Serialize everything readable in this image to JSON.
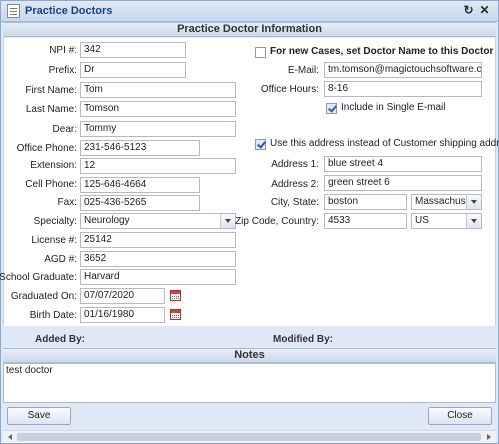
{
  "window": {
    "title": "Practice Doctors",
    "icon": "document-list-icon",
    "refresh_icon": "refresh-icon",
    "close_icon": "close-icon"
  },
  "section_title": "Practice Doctor Information",
  "left": {
    "npi": {
      "label": "NPI #:",
      "value": "342"
    },
    "prefix": {
      "label": "Prefix:",
      "value": "Dr"
    },
    "first_name": {
      "label": "First Name:",
      "value": "Tom"
    },
    "last_name": {
      "label": "Last Name:",
      "value": "Tomson"
    },
    "dear": {
      "label": "Dear:",
      "value": "Tommy"
    },
    "office_phone": {
      "label": "Office Phone:",
      "value": "231-546-5123"
    },
    "extension": {
      "label": "Extension:",
      "value": "12"
    },
    "cell_phone": {
      "label": "Cell Phone:",
      "value": "125-646-4664"
    },
    "fax": {
      "label": "Fax:",
      "value": "025-436-5265"
    },
    "specialty": {
      "label": "Specialty:",
      "value": "Neurology"
    },
    "license": {
      "label": "License #:",
      "value": "25142"
    },
    "agd": {
      "label": "AGD #:",
      "value": "3652"
    },
    "school": {
      "label": "School Graduate:",
      "value": "Harvard"
    },
    "graduated": {
      "label": "Graduated On:",
      "value": "07/07/2020"
    },
    "birth": {
      "label": "Birth Date:",
      "value": "01/16/1980"
    }
  },
  "right": {
    "new_cases": {
      "label": "For new Cases, set Doctor Name to this Doctor",
      "checked": false
    },
    "email": {
      "label": "E-Mail:",
      "value": "tm.tomson@magictouchsoftware.com"
    },
    "office_hours": {
      "label": "Office Hours:",
      "value": "8-16"
    },
    "include_email": {
      "label": "Include in Single E-mail",
      "checked": true
    },
    "use_address": {
      "label": "Use this address instead of Customer shipping address",
      "checked": true
    },
    "address1": {
      "label": "Address 1:",
      "value": "blue street 4"
    },
    "address2": {
      "label": "Address 2:",
      "value": "green street 6"
    },
    "city_state": {
      "label": "City, State:",
      "city": "boston",
      "state": "Massachusetts"
    },
    "zip_country": {
      "label": "Zip Code, Country:",
      "zip": "4533",
      "country": "US"
    }
  },
  "meta": {
    "added_by": "Added By:",
    "modified_by": "Modified By:"
  },
  "notes": {
    "title": "Notes",
    "value": "test doctor"
  },
  "buttons": {
    "save": "Save",
    "close": "Close"
  }
}
